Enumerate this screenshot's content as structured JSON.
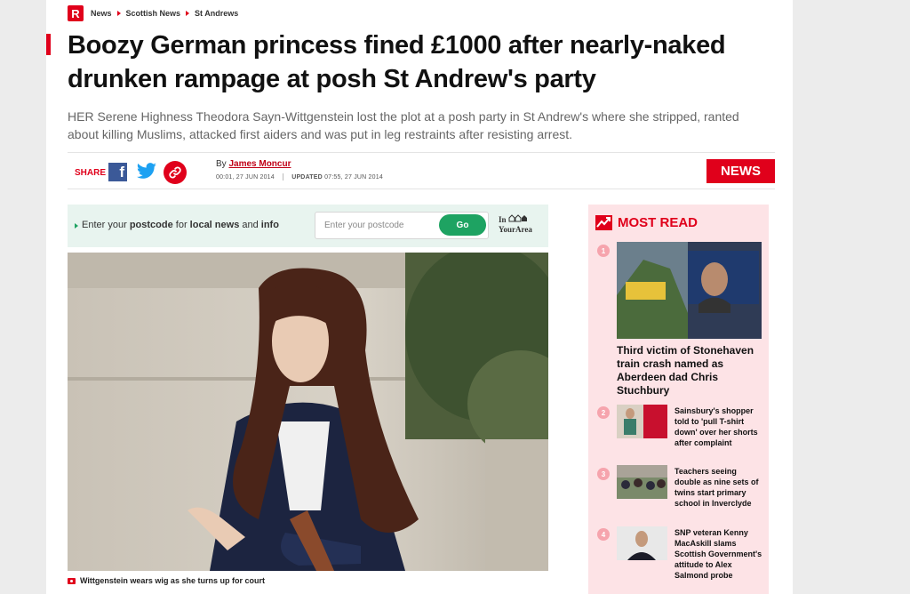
{
  "brand": {
    "logo_letter": "R",
    "accent": "#e0001b"
  },
  "breadcrumb": [
    "News",
    "Scottish News",
    "St Andrews"
  ],
  "article": {
    "headline": "Boozy German princess fined £1000 after nearly-naked drunken rampage at posh St Andrew's party",
    "standfirst": "HER Serene Highness Theodora Sayn-Wittgenstein lost the plot at a posh party in St Andrew's where she stripped, ranted about killing Muslims, attacked first aiders and was put in leg restraints after resisting arrest.",
    "share_label": "SHARE",
    "by_label": "By",
    "author": "James Moncur",
    "published": "00:01, 27 JUN 2014",
    "updated_label": "UPDATED",
    "updated": "07:55, 27 JUN 2014",
    "section_badge": "NEWS",
    "caption": "Wittgenstein wears wig as she turns up for court"
  },
  "postcode_widget": {
    "text_1": "Enter your ",
    "text_bold_1": "postcode",
    "text_2": " for ",
    "text_bold_2": "local news",
    "text_3": " and ",
    "text_bold_3": "info",
    "placeholder": "Enter your postcode",
    "button": "Go",
    "brand_line_1": "In",
    "brand_line_2": "YourArea"
  },
  "most_read": {
    "title": "MOST READ",
    "items": [
      {
        "rank": "1",
        "title": "Third victim of Stonehaven train crash named as Aberdeen dad Chris Stuchbury"
      },
      {
        "rank": "2",
        "title": "Sainsbury's shopper told to 'pull T-shirt down' over her shorts after complaint"
      },
      {
        "rank": "3",
        "title": "Teachers seeing double as nine sets of twins start primary school in Inverclyde"
      },
      {
        "rank": "4",
        "title": "SNP veteran Kenny MacAskill slams Scottish Government's attitude to Alex Salmond probe"
      }
    ]
  },
  "icons": [
    "facebook-icon",
    "twitter-icon",
    "link-icon",
    "camera-icon",
    "trending-icon"
  ]
}
